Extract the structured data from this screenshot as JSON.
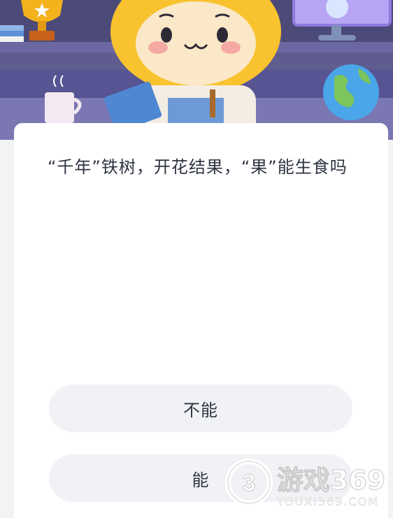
{
  "question": {
    "text": "“千年”铁树，开花结果，“果”能生食吗"
  },
  "answers": [
    {
      "label": "不能"
    },
    {
      "label": "能"
    }
  ],
  "watermark": {
    "logo_text": "游戏369",
    "url_text": "YOUXI369.COM"
  }
}
